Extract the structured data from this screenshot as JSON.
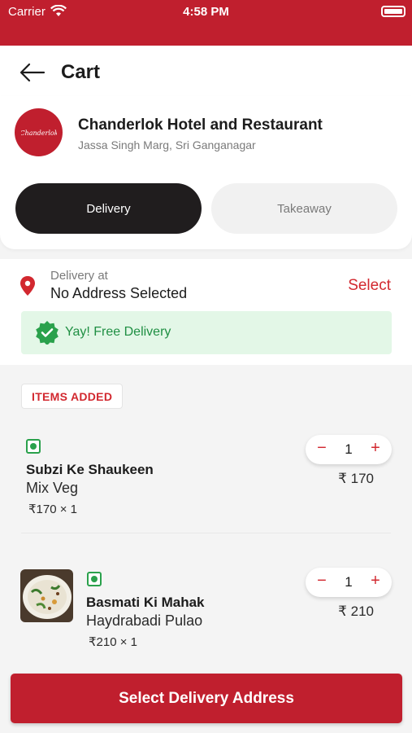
{
  "status_bar": {
    "carrier": "Carrier",
    "time": "4:58 PM"
  },
  "header": {
    "title": "Cart"
  },
  "restaurant": {
    "name": "Chanderlok Hotel and Restaurant",
    "address": "Jassa Singh Marg, Sri Ganganagar",
    "logo_text": "Chanderlok"
  },
  "order_mode": {
    "delivery_label": "Delivery",
    "takeaway_label": "Takeaway",
    "selected": "Delivery"
  },
  "delivery": {
    "label": "Delivery at",
    "address": "No Address Selected",
    "select_label": "Select",
    "free_text": "Yay! Free Delivery"
  },
  "items_badge": "ITEMS ADDED",
  "items": [
    {
      "name": "Subzi Ke Shaukeen",
      "subtitle": "Mix Veg",
      "qty_line": "₹170 × 1",
      "count": "1",
      "price": "₹ 170",
      "has_image": false
    },
    {
      "name": "Basmati Ki Mahak",
      "subtitle": "Haydrabadi Pulao",
      "qty_line": "₹210 × 1",
      "count": "1",
      "price": "₹ 210",
      "has_image": true
    }
  ],
  "stepper": {
    "minus": "−",
    "plus": "+"
  },
  "cta_label": "Select Delivery Address",
  "colors": {
    "brand_red": "#c01f2e",
    "dark": "#201d1e",
    "veg_green": "#2aa14c",
    "banner_green": "#e3f7e7"
  },
  "icons": [
    "wifi-icon",
    "battery-icon",
    "back-arrow-icon",
    "location-pin-icon",
    "verified-check-icon",
    "veg-indicator-icon"
  ]
}
